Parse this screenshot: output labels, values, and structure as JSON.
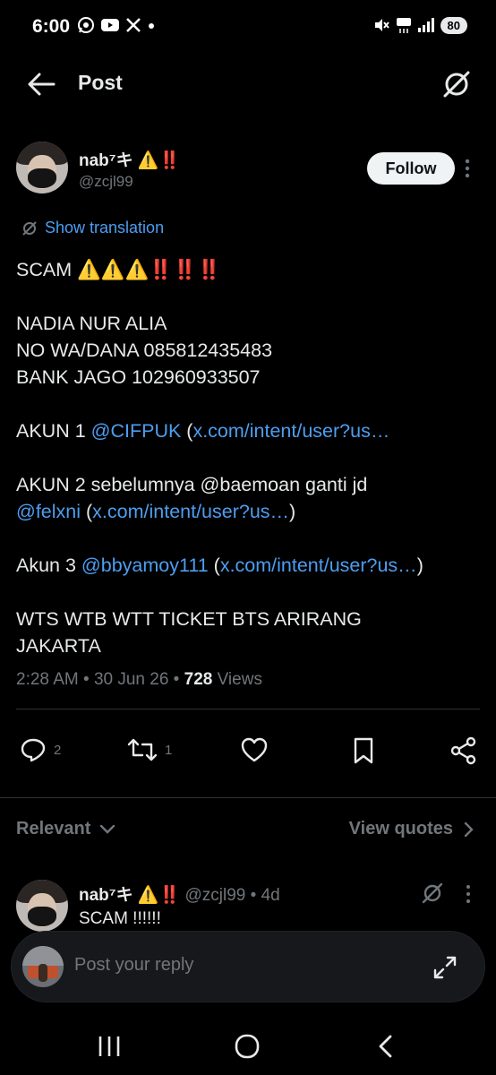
{
  "status_bar": {
    "time": "6:00",
    "left_icons": [
      "whatsapp-icon",
      "youtube-icon",
      "x-icon",
      "dot"
    ],
    "right_icons": [
      "mute-icon",
      "5g-icon",
      "signal-icon"
    ],
    "battery": "80"
  },
  "header": {
    "title": "Post"
  },
  "author": {
    "name": "nab⁷キ ⚠️‼️",
    "handle": "@zcjl99",
    "follow_label": "Follow"
  },
  "translation_label": "Show translation",
  "post": {
    "l1": "SCAM ⚠️⚠️⚠️‼️‼️‼️",
    "l2": "NADIA NUR ALIA",
    "l3": "NO WA/DANA 085812435483",
    "l4": "BANK JAGO 102960933507",
    "l5_prefix": "AKUN 1 ",
    "l5_mention": "@CIFPUK",
    "l5_open": " (",
    "l5_link": "x.com/intent/user?us…",
    "l6": "AKUN 2 sebelumnya @baemoan ganti jd",
    "l7_mention": "@felxni",
    "l7_open": " (",
    "l7_link": "x.com/intent/user?us…",
    "l7_close": ")",
    "l8_prefix": "Akun 3 ",
    "l8_mention": "@bbyamoy111",
    "l8_open": " (",
    "l8_link": "x.com/intent/user?us…",
    "l8_close": ")",
    "l9": "WTS WTB WTT TICKET BTS ARIRANG",
    "l10": "JAKARTA"
  },
  "meta": {
    "time": "2:28 AM",
    "sep1": " • ",
    "date": "30 Jun 26",
    "sep2": " • ",
    "views_count": "728",
    "views_label": " Views"
  },
  "actions": {
    "replies": "2",
    "reposts": "1"
  },
  "filter": {
    "relevant_label": "Relevant",
    "view_quotes_label": "View quotes"
  },
  "reply": {
    "name": "nab⁷キ ⚠️‼️",
    "handle": "@zcjl99",
    "sep": " • ",
    "time": "4d",
    "text": "SCAM !!!!!!"
  },
  "composer": {
    "placeholder": "Post your reply"
  },
  "colors": {
    "background": "#000000",
    "text": "#e7e9ea",
    "muted": "#71767b",
    "link": "#4d9ef0",
    "divider": "#2f3336"
  }
}
